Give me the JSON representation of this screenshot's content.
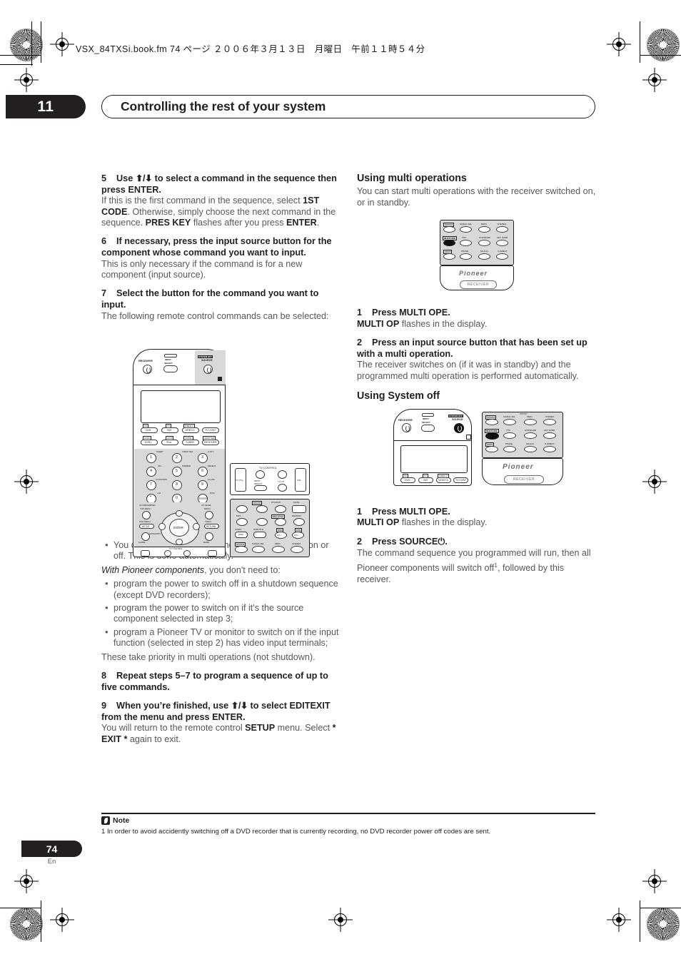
{
  "document": {
    "file_header": "VSX_84TXSi.book.fm  74 ページ  ２００６年３月１３日　月曜日　午前１１時５４分",
    "chapter_number": "11",
    "chapter_title": "Controlling the rest of your system",
    "page_number": "74",
    "page_language": "En"
  },
  "left_column": {
    "step5": {
      "num": "5",
      "head_before_arrows": "Use ",
      "arrows": "⬆/⬇",
      "head_after_arrows": " to select a command in the sequence then press ENTER.",
      "body_1": "If this is the first command in the sequence, select ",
      "body_bold_1": "1ST CODE",
      "body_2": ". Otherwise, simply choose the next command in the sequence. ",
      "body_bold_2": "PRES KEY",
      "body_3": " flashes after you press ",
      "body_bold_3": "ENTER",
      "body_4": "."
    },
    "step6": {
      "num": "6",
      "head": "If necessary, press the input source button for the component whose command you want to input.",
      "body": "This is only necessary if the command is for a new component (input source)."
    },
    "step7": {
      "num": "7",
      "head": "Select the button for the command you want to input.",
      "body": "The following remote control commands can be selected:"
    },
    "bullets_1": [
      "You don't need to program the receiver to switch on or off. This is done automatically."
    ],
    "pioneer_intro_italic": "With Pioneer components",
    "pioneer_intro_rest": ", you don't need to:",
    "bullets_2": [
      "program the power to switch off in a shutdown sequence (except DVD recorders);",
      "program the power to switch on if it's the source component selected in step 3;",
      "program a Pioneer TV or monitor to switch on if the input function (selected in step 2) has video input terminals;"
    ],
    "priority_line": "These take priority in multi operations (not shutdown).",
    "step8": {
      "num": "8",
      "head": "Repeat steps 5–7 to program a sequence of up to five commands."
    },
    "step9": {
      "num": "9",
      "head_before_arrows": "When you’re finished, use ",
      "arrows": "⬆/⬇",
      "head_after_arrows": " to select EDITEXIT from the menu and press ENTER.",
      "body_1": "You will return to the remote control ",
      "body_bold_1": "SETUP",
      "body_2": " menu. Select ",
      "body_bold_2": "* EXIT *",
      "body_3": " again to exit."
    }
  },
  "right_column": {
    "multi_ops": {
      "heading": "Using multi operations",
      "intro": "You can start multi operations with the receiver switched on, or in standby.",
      "step1": {
        "num": "1",
        "head": "Press MULTI OPE.",
        "body_bold": "MULTI OP",
        "body_rest": " flashes in the display."
      },
      "step2": {
        "num": "2",
        "head": "Press an input source button that has been set up with a multi operation.",
        "body": "The receiver switches on (if it was in standby) and the programmed multi operation is performed automatically."
      }
    },
    "system_off": {
      "heading": "Using System off",
      "step1": {
        "num": "1",
        "head": "Press MULTI OPE.",
        "body_bold": "MULTI OP",
        "body_rest": " flashes in the display."
      },
      "step2": {
        "num": "2",
        "head": "Press  SOURCE⏻.",
        "body_1": "The command sequence you programmed will run, then all Pioneer components will switch off",
        "body_sup": "1",
        "body_2": ", followed by this receiver."
      }
    }
  },
  "note": {
    "label": "Note",
    "text": "1 In order to avoid accidently switching off a DVD recorder that is currently recording, no DVD recorder power off codes are sent."
  },
  "remote_labels": {
    "receiver": "RECEIVER",
    "input_select_top": "INPUT",
    "input_select_bottom": "SELECT",
    "system_off": "SYSTEM OFF",
    "source": "SOURCE",
    "multi_ope": "MULTI OPE",
    "shift": "SHIFT",
    "status": "STATUS",
    "pioneer": "Pioneer",
    "receiver_pill": "RECEIVER",
    "tv_control": "TV CONTROL",
    "tv_vol": "TV VOL",
    "tv_ch": "TV CH",
    "vol": "VOL",
    "enter": "ENTER",
    "setup": "SETUP",
    "return": "RETURN",
    "guide": "GUIDE",
    "band": "BAND",
    "category": "CATEGORY",
    "t_edit": "T.EDIT",
    "ch_level": "CH LEVEL",
    "menu": "MENU",
    "av_parameter": "AV PARAMETER",
    "top_menu": "TOP MENU",
    "dvd_menu": "DVD MENU",
    "source_keys_row1": [
      "DVD",
      "SAT",
      "VIDEO 1",
      "TV CONT"
    ],
    "source_keys_row2": [
      "DVR1",
      "iPod",
      "TUNER",
      "RECEIVER"
    ],
    "source_keys_sub1": [
      "CD",
      "TV",
      "VIDEO 2",
      ""
    ],
    "source_keys_sub2": [
      "DVR2",
      "CD-R",
      "CD/MD",
      "ADAPTER"
    ],
    "numpad": [
      "1",
      "2",
      "3",
      "4",
      "5",
      "6",
      "7",
      "8",
      "9",
      "•",
      "0",
      "ENTER"
    ],
    "numpad_subs": [
      "SLEEP",
      "VIDEO SEL",
      "A.ATT",
      "SP+",
      "DIMMER",
      "DEFEAT",
      "CLOCK/DIS",
      "",
      "CLASS",
      "+10",
      "",
      "DISC"
    ],
    "transport_subs": [
      "MPX",
      "",
      "",
      "",
      "AUDIO",
      "SUBTITLE",
      "",
      ""
    ],
    "fn_row": [
      "SIGNAL SEL",
      "MIDN",
      "STEREO"
    ],
    "fn_row2": [
      "THX",
      "STANDARD",
      "ADV SURR"
    ],
    "fn_row3": [
      "PHASE",
      "MCACC",
      "S.DIRECT"
    ],
    "photo": "PHOTO",
    "dtv_dvd": "DTV/DVD",
    "mute": "MUTE",
    "rec_stop": "REC STOP",
    "memory": "MEMORY",
    "hdd": "HDD",
    "dvd": "DVD",
    "disp": "DISP",
    "ch_minus": "CH–",
    "ch_plus": "CH+"
  }
}
